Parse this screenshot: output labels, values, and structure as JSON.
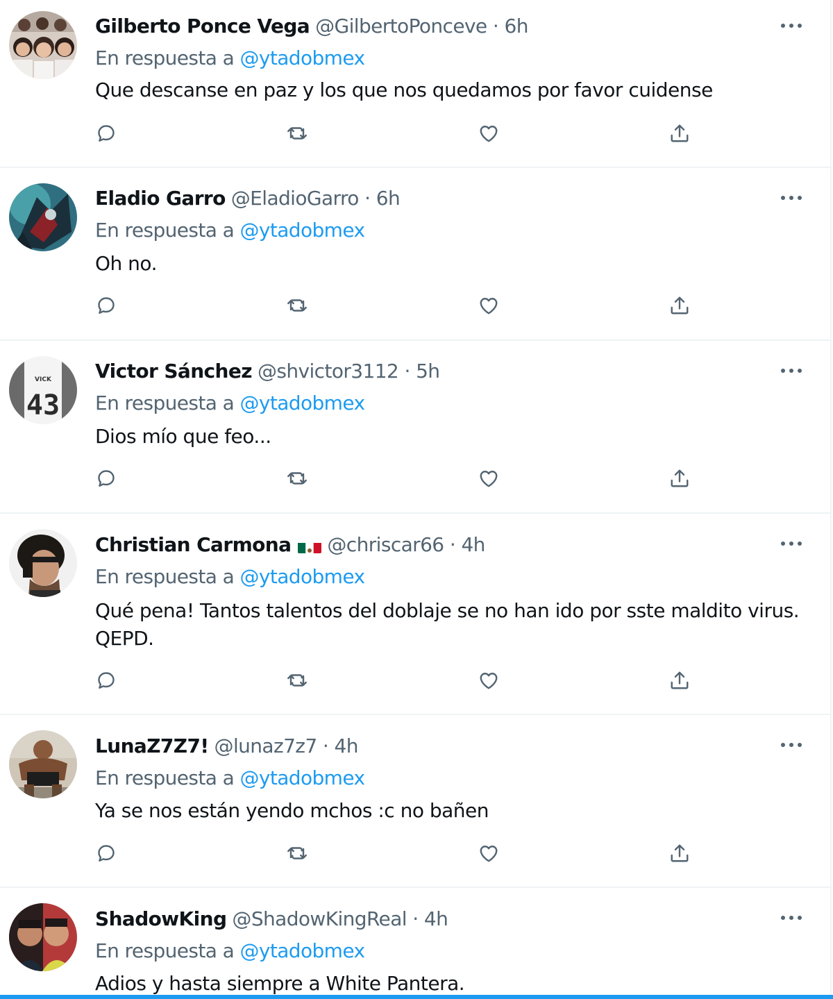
{
  "tweets": [
    {
      "name": "Gilberto Ponce Vega",
      "handle": "@GilbertoPonceve",
      "sep": "·",
      "time": "6h",
      "reply_prefix": "En respuesta a",
      "reply_to": "@ytadobmex",
      "text": "Que descanse en paz y los que nos quedamos por favor cuidense"
    },
    {
      "name": "Eladio Garro",
      "handle": "@EladioGarro",
      "sep": "·",
      "time": "6h",
      "reply_prefix": "En respuesta a",
      "reply_to": "@ytadobmex",
      "text": "Oh no."
    },
    {
      "name": "Victor Sánchez",
      "handle": "@shvictor3112",
      "sep": "·",
      "time": "5h",
      "reply_prefix": "En respuesta a",
      "reply_to": "@ytadobmex",
      "text": "Dios mío que feo...",
      "avatar_text": "VICK",
      "avatar_number": "43"
    },
    {
      "name": "Christian Carmona",
      "handle": "@chriscar66",
      "sep": "·",
      "time": "4h",
      "reply_prefix": "En respuesta a",
      "reply_to": "@ytadobmex",
      "text": "Qué pena! Tantos talentos del doblaje se no han ido por sste maldito virus. QEPD."
    },
    {
      "name": "LunaZ7Z7!",
      "handle": "@lunaz7z7",
      "sep": "·",
      "time": "4h",
      "reply_prefix": "En respuesta a",
      "reply_to": "@ytadobmex",
      "text": "Ya se nos están yendo mchos :c no bañen"
    },
    {
      "name": "ShadowKing",
      "handle": "@ShadowKingReal",
      "sep": "·",
      "time": "4h",
      "reply_prefix": "En respuesta a",
      "reply_to": "@ytadobmex",
      "text": "Adios y hasta siempre a White Pantera."
    }
  ],
  "icons": {
    "reply": "speech-bubble-icon",
    "retweet": "retweet-icon",
    "like": "heart-icon",
    "share": "share-upload-icon",
    "more": "more-dots-icon",
    "flag": "mexico-flag-icon"
  },
  "colors": {
    "accent": "#1d9bf0",
    "secondary_text": "#536471",
    "primary_text": "#0f1419",
    "divider": "#eff3f4"
  }
}
